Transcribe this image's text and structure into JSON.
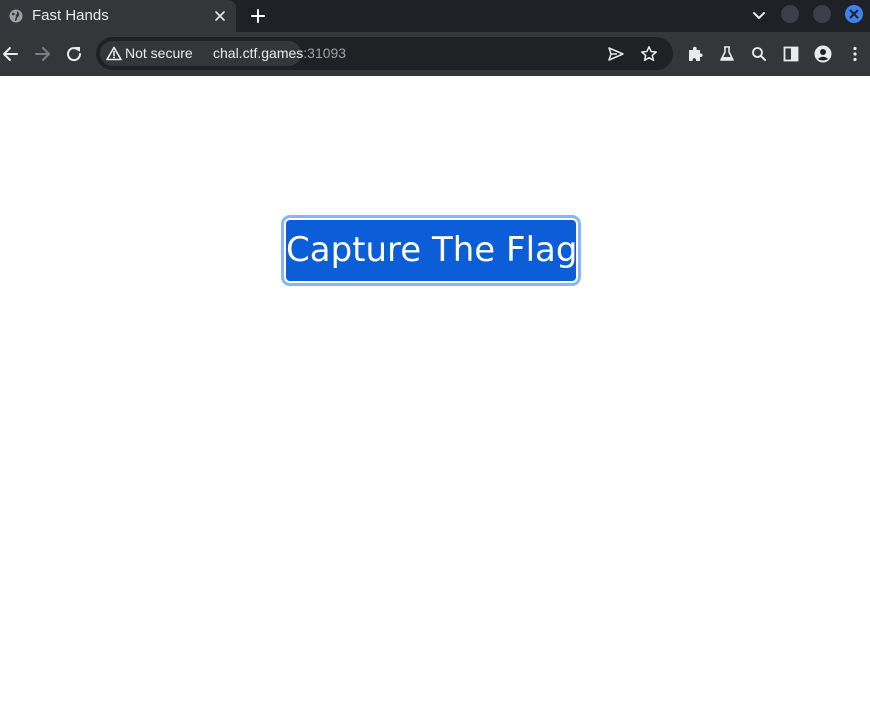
{
  "tab": {
    "title": "Fast Hands",
    "favicon_icon": "globe-icon",
    "close_icon": "close-icon"
  },
  "tabstrip": {
    "new_tab_icon": "plus-icon",
    "tab_search_icon": "chevron-down-icon",
    "window_controls": [
      "minimize",
      "maximize",
      "close"
    ]
  },
  "toolbar": {
    "back_icon": "arrow-left-icon",
    "forward_icon": "arrow-right-icon",
    "reload_icon": "reload-icon",
    "security_label": "Not secure",
    "security_icon": "warning-icon",
    "url_host": "chal.ctf.games",
    "url_port": ":31093",
    "send_icon": "send-icon",
    "bookmark_icon": "star-icon",
    "extensions_icon": "puzzle-icon",
    "labs_icon": "flask-icon",
    "search_icon": "search-icon",
    "side_panel_icon": "side-panel-icon",
    "profile_icon": "avatar-icon",
    "menu_icon": "kebab-menu-icon"
  },
  "page": {
    "button_label": "Capture The Flag"
  },
  "colors": {
    "tabstrip_bg": "#1f2127",
    "toolbar_bg": "#35363a",
    "omnibox_bg": "#202124",
    "button_bg": "#0b5ed7",
    "button_focus_ring": "#86b7fe",
    "window_close": "#3d82ef"
  }
}
